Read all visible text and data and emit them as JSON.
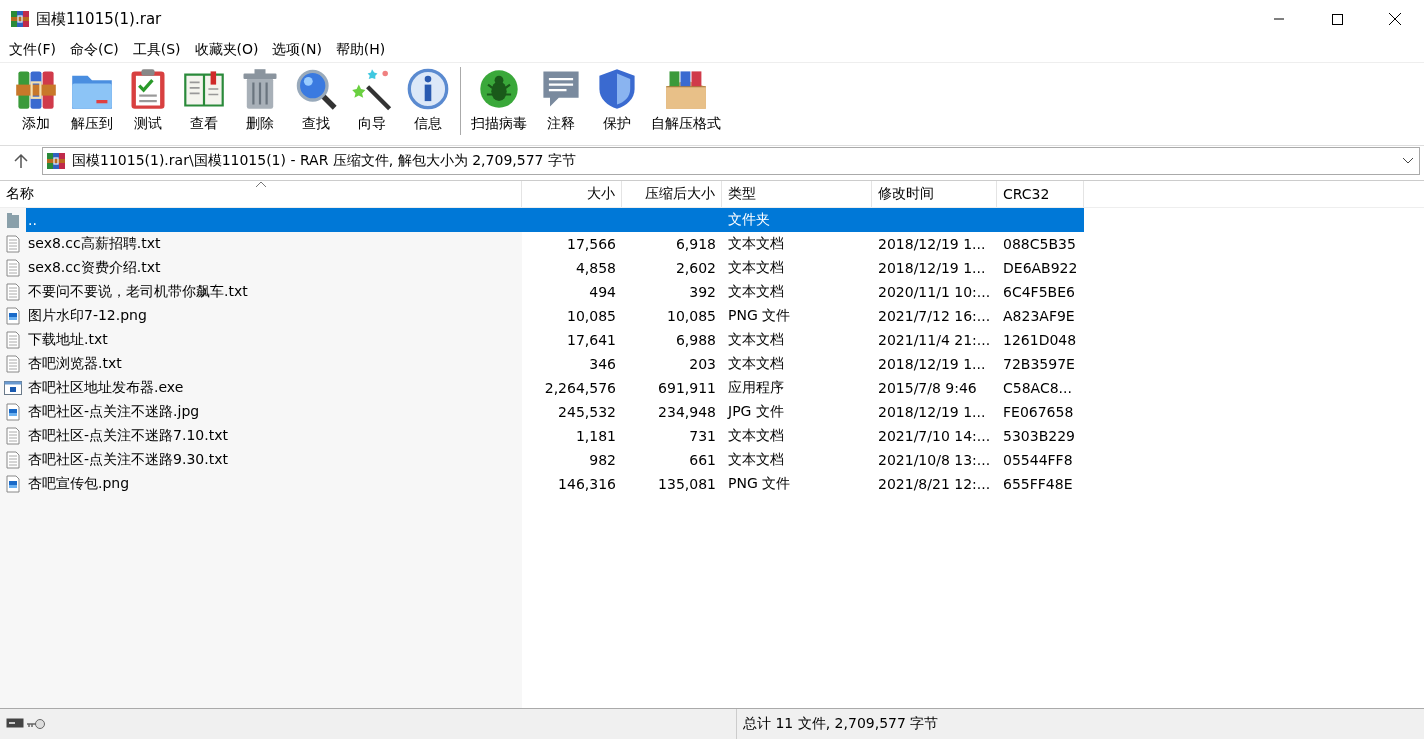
{
  "window": {
    "title": "国模11015(1).rar"
  },
  "menu": [
    "文件(F)",
    "命令(C)",
    "工具(S)",
    "收藏夹(O)",
    "选项(N)",
    "帮助(H)"
  ],
  "toolbar": {
    "groups": [
      [
        {
          "label": "添加",
          "kind": "add"
        },
        {
          "label": "解压到",
          "kind": "extract"
        },
        {
          "label": "测试",
          "kind": "test"
        },
        {
          "label": "查看",
          "kind": "view"
        },
        {
          "label": "删除",
          "kind": "delete"
        },
        {
          "label": "查找",
          "kind": "find"
        },
        {
          "label": "向导",
          "kind": "wizard"
        },
        {
          "label": "信息",
          "kind": "info"
        }
      ],
      [
        {
          "label": "扫描病毒",
          "kind": "virus"
        },
        {
          "label": "注释",
          "kind": "comment"
        },
        {
          "label": "保护",
          "kind": "protect"
        },
        {
          "label": "自解压格式",
          "kind": "sfx"
        }
      ]
    ]
  },
  "address": {
    "path": "国模11015(1).rar\\国模11015(1) - RAR 压缩文件, 解包大小为 2,709,577 字节"
  },
  "table": {
    "columns": [
      {
        "label": "名称",
        "sorted": true
      },
      {
        "label": "大小",
        "sorted": false
      },
      {
        "label": "压缩后大小",
        "sorted": false
      },
      {
        "label": "类型",
        "sorted": false
      },
      {
        "label": "修改时间",
        "sorted": false
      },
      {
        "label": "CRC32",
        "sorted": false
      }
    ],
    "rows": [
      {
        "kind": "folder",
        "name": "..",
        "type": "文件夹",
        "selected": true
      },
      {
        "kind": "text",
        "name": "sex8.cc高薪招聘.txt",
        "size": "17,566",
        "packed": "6,918",
        "type": "文本文档",
        "modified": "2018/12/19 1...",
        "crc": "088C5B35",
        "selected": false
      },
      {
        "kind": "text",
        "name": "sex8.cc资费介绍.txt",
        "size": "4,858",
        "packed": "2,602",
        "type": "文本文档",
        "modified": "2018/12/19 1...",
        "crc": "DE6AB922",
        "selected": false
      },
      {
        "kind": "text",
        "name": "不要问不要说，老司机带你飙车.txt",
        "size": "494",
        "packed": "392",
        "type": "文本文档",
        "modified": "2020/11/1 10:...",
        "crc": "6C4F5BE6",
        "selected": false
      },
      {
        "kind": "image",
        "name": "图片水印7-12.png",
        "size": "10,085",
        "packed": "10,085",
        "type": "PNG 文件",
        "modified": "2021/7/12 16:...",
        "crc": "A823AF9E",
        "selected": false
      },
      {
        "kind": "text",
        "name": "下载地址.txt",
        "size": "17,641",
        "packed": "6,988",
        "type": "文本文档",
        "modified": "2021/11/4 21:...",
        "crc": "1261D048",
        "selected": false
      },
      {
        "kind": "text",
        "name": "杏吧浏览器.txt",
        "size": "346",
        "packed": "203",
        "type": "文本文档",
        "modified": "2018/12/19 1...",
        "crc": "72B3597E",
        "selected": false
      },
      {
        "kind": "exe",
        "name": "杏吧社区地址发布器.exe",
        "size": "2,264,576",
        "packed": "691,911",
        "type": "应用程序",
        "modified": "2015/7/8 9:46",
        "crc": "C58AC8...",
        "selected": false
      },
      {
        "kind": "image",
        "name": "杏吧社区-点关注不迷路.jpg",
        "size": "245,532",
        "packed": "234,948",
        "type": "JPG 文件",
        "modified": "2018/12/19 1...",
        "crc": "FE067658",
        "selected": false
      },
      {
        "kind": "text",
        "name": "杏吧社区-点关注不迷路7.10.txt",
        "size": "1,181",
        "packed": "731",
        "type": "文本文档",
        "modified": "2021/7/10 14:...",
        "crc": "5303B229",
        "selected": false
      },
      {
        "kind": "text",
        "name": "杏吧社区-点关注不迷路9.30.txt",
        "size": "982",
        "packed": "661",
        "type": "文本文档",
        "modified": "2021/10/8 13:...",
        "crc": "05544FF8",
        "selected": false
      },
      {
        "kind": "image",
        "name": "杏吧宣传包.png",
        "size": "146,316",
        "packed": "135,081",
        "type": "PNG 文件",
        "modified": "2021/8/21 12:...",
        "crc": "655FF48E",
        "selected": false
      }
    ]
  },
  "status_bar": {
    "text": "总计 11 文件, 2,709,577 字节"
  }
}
